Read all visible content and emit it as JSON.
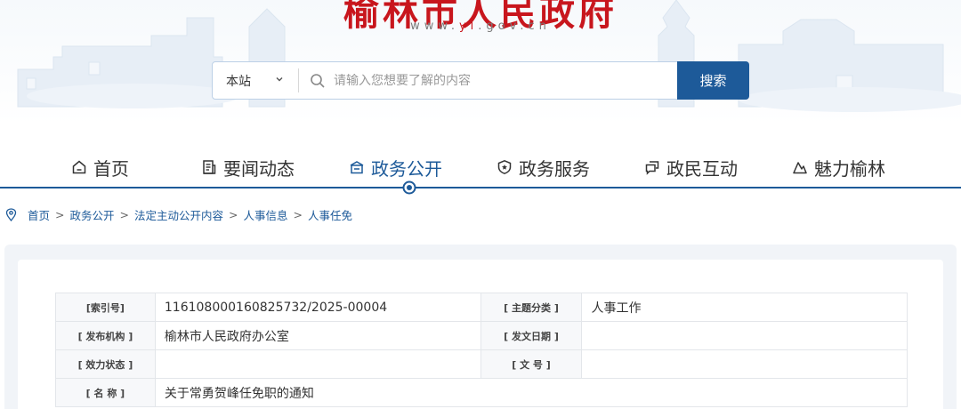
{
  "header": {
    "title": "榆林市人民政府",
    "url_prefix": "www.",
    "url_accent": "yl",
    "url_suffix": ".gov.cn"
  },
  "search": {
    "scope": "本站",
    "placeholder": "请输入您想要了解的内容",
    "button": "搜索"
  },
  "nav": {
    "items": [
      {
        "label": "首页",
        "icon": "home-icon"
      },
      {
        "label": "要闻动态",
        "icon": "news-icon"
      },
      {
        "label": "政务公开",
        "icon": "government-icon",
        "active": true
      },
      {
        "label": "政务服务",
        "icon": "shield-icon"
      },
      {
        "label": "政民互动",
        "icon": "chat-icon"
      },
      {
        "label": "魅力榆林",
        "icon": "mountain-icon"
      }
    ]
  },
  "breadcrumb": {
    "items": [
      "首页",
      "政务公开",
      "法定主动公开内容",
      "人事信息",
      "人事任免"
    ],
    "separator": ">"
  },
  "meta": {
    "index_key": "[索引号]",
    "index_value": "11610800016082573​2/2025-00004",
    "topic_key": "[ 主题分类 ]",
    "topic_value": "人事工作",
    "publisher_key": "[ 发布机构 ]",
    "publisher_value": "榆林市人民政府办公室",
    "date_key": "[ 发文日期 ]",
    "date_value": "",
    "status_key": "[ 效力状态 ]",
    "status_value": "",
    "docno_key": "[ 文 号 ]",
    "docno_value": "",
    "name_key": "[ 名 称 ]",
    "name_value": "关于常勇贺峰任免职的通知"
  },
  "colors": {
    "brand_red": "#c8161d",
    "brand_blue": "#1d5a99"
  }
}
